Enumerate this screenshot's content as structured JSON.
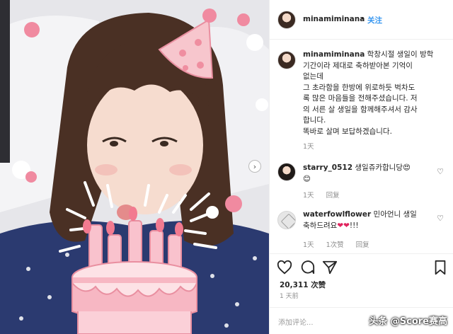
{
  "post": {
    "username": "minamiminana",
    "follow_label": "关注",
    "separator": "•",
    "caption_lines": [
      "학창시절 생일이 방학",
      "기간이라 제대로 축하받아본 기억이",
      "없는데",
      "그 초라함을 한방에 위로하듯 벅차도",
      "록 많은 마음들을 전해주셨습니다. 저",
      "의 서른 살 생일을 함께해주셔서 감사",
      "합니다.",
      "똑바로 살며 보답하겠습니다."
    ],
    "caption_time": "1天"
  },
  "comments": [
    {
      "username": "starry_0512",
      "text_line1": "생일쥬카합니당",
      "text_line2_emoji": "😊",
      "emoji_inline": "😍",
      "time": "1天",
      "reply_label": "回复"
    },
    {
      "username": "waterfowlflower",
      "text_line1": "민아언니 생일",
      "text_line2": "축하드려요",
      "hearts": "❤❤",
      "exclaim": "!!!",
      "time": "1天",
      "likes": "1次赞",
      "reply_label": "回复"
    }
  ],
  "actions": {
    "likes_count": "20,311 次赞",
    "posted_ago": "1 天前",
    "comment_placeholder": "添加评论..."
  },
  "watermark": "头条 @Score赛高",
  "icons": [
    "heart-icon",
    "comment-icon",
    "share-icon",
    "bookmark-icon",
    "chevron-right-icon"
  ],
  "colors": {
    "follow": "#3897f0",
    "meta": "#8e8e8e",
    "border": "#efefef",
    "cake_pink": "#f4a6b4"
  }
}
